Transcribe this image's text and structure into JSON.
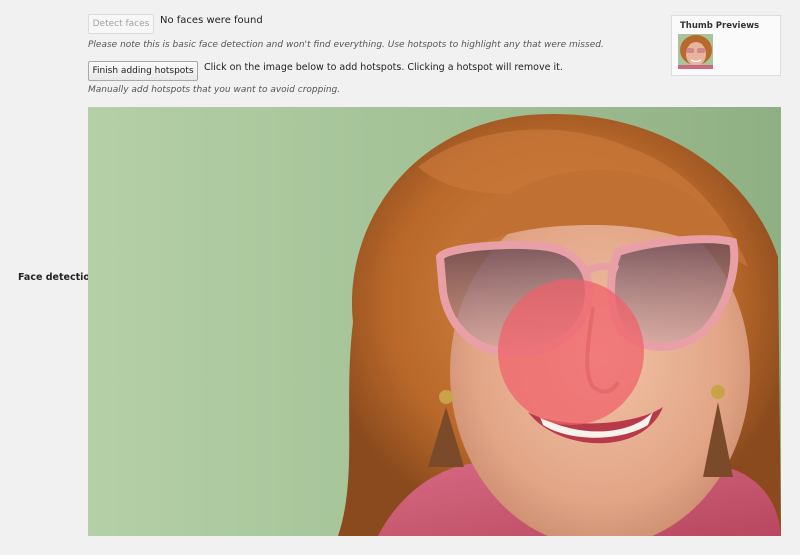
{
  "row_label": "Face detection",
  "toolbar": {
    "detect_label": "Detect faces",
    "status": "No faces were found",
    "note": "Please note this is basic face detection and won't find everything. Use hotspots to highlight any that were missed.",
    "finish_label": "Finish adding hotspots",
    "hint": "Click on the image below to add hotspots. Clicking a hotspot will remove it.",
    "manual_note": "Manually add hotspots that you want to avoid cropping."
  },
  "thumbs": {
    "title": "Thumb Previews"
  },
  "colors": {
    "background": "#f1f1f1",
    "hotspot": "#f0606a",
    "photo_backdrop": "#a9c49d"
  },
  "image": {
    "hotspot_count": 1
  }
}
